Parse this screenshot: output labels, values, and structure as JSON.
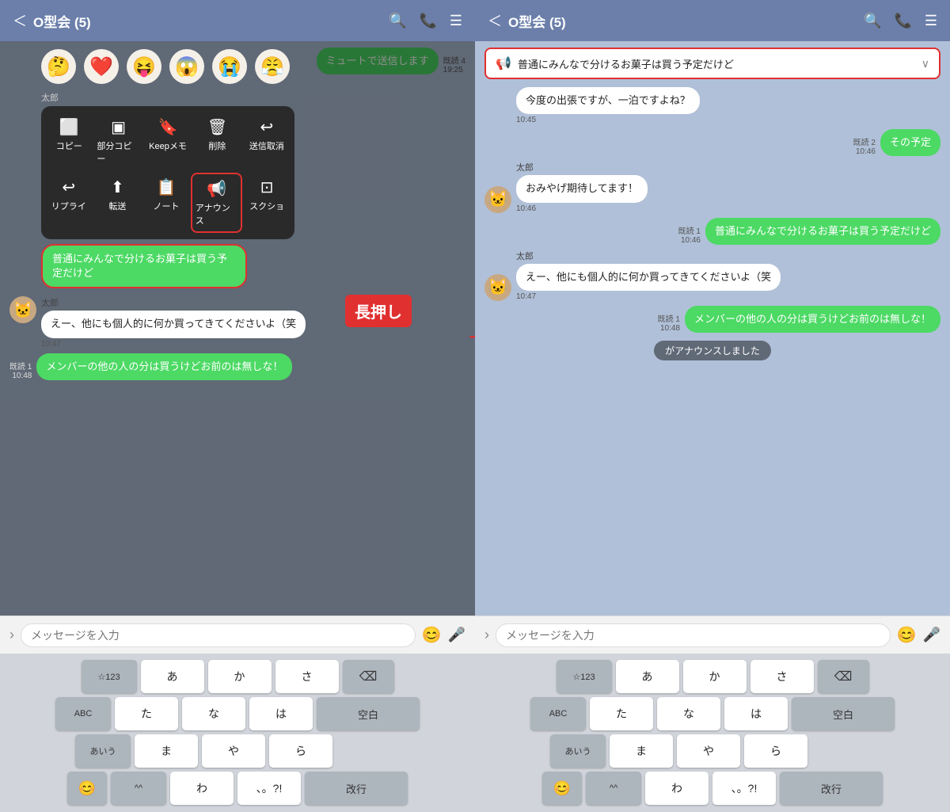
{
  "left_panel": {
    "header": {
      "back": "＜",
      "title": "O型会 (5)",
      "search": "🔍",
      "phone": "📞",
      "menu": "≡"
    },
    "top_message": {
      "read": "既読 4",
      "time": "19:25",
      "text": "ミュートで送信します",
      "align": "right"
    },
    "stickers": [
      "🤔",
      "❤️",
      "😝",
      "😱",
      "😭",
      "😤"
    ],
    "context_menu": {
      "row1": [
        {
          "icon": "⬜",
          "label": "コピー"
        },
        {
          "icon": "▣",
          "label": "部分コピー"
        },
        {
          "icon": "🔖",
          "label": "Keepメモ"
        },
        {
          "icon": "🗑",
          "label": "削除"
        },
        {
          "icon": "↩",
          "label": "送信取消"
        }
      ],
      "row2": [
        {
          "icon": "↩",
          "label": "リプライ"
        },
        {
          "icon": "⬆",
          "label": "転送"
        },
        {
          "icon": "📋",
          "label": "ノート"
        },
        {
          "icon": "📢",
          "label": "アナウンス",
          "highlighted": true
        },
        {
          "icon": "⊡",
          "label": "スクショ"
        }
      ]
    },
    "highlighted_message": {
      "text": "普通にみんなで分けるお菓子は買う予定だけど",
      "align": "right",
      "color": "green",
      "border": true
    },
    "messages": [
      {
        "sender": "太郎",
        "avatar": "🐱",
        "text": "えー、他にも個人的に何か買ってきてくださいよ（笑",
        "time": "10:47",
        "align": "left"
      },
      {
        "text": "メンバーの他の人の分は買うけどお前のは無しな！",
        "read": "既読 1",
        "time": "10:48",
        "align": "right",
        "color": "green"
      }
    ],
    "long_press_label": "長押し",
    "input_placeholder": "メッセージを入力",
    "keyboard": {
      "row1": [
        "☆123",
        "あ",
        "か",
        "さ",
        "⌫"
      ],
      "row2": [
        "ABC",
        "た",
        "な",
        "は",
        "空白"
      ],
      "row3": [
        "あいう",
        "ま",
        "や",
        "ら",
        ""
      ],
      "row4": [
        "😊",
        "^^",
        "わ",
        "、。?!",
        "改行"
      ]
    }
  },
  "right_panel": {
    "header": {
      "back": "＜",
      "title": "O型会 (5)",
      "search": "🔍",
      "phone": "📞",
      "menu": "≡"
    },
    "announcement": {
      "icon": "📢",
      "text": "普通にみんなで分けるお菓子は買う予定だけど",
      "chevron": "∨"
    },
    "messages": [
      {
        "text": "今度の出張ですが、一泊ですよね？",
        "time": "10:45",
        "align": "left",
        "no_avatar": true
      },
      {
        "text": "その予定",
        "read": "既読 2",
        "time": "10:46",
        "align": "right",
        "color": "green"
      },
      {
        "sender": "太郎",
        "avatar": "🐱",
        "text": "おみやげ期待してます！",
        "time": "10:46",
        "align": "left"
      },
      {
        "text": "普通にみんなで分けるお菓子は買う予定だけど",
        "read": "既読 1",
        "time": "10:46",
        "align": "right",
        "color": "green"
      },
      {
        "sender": "太郎",
        "avatar": "🐱",
        "text": "えー、他にも個人的に何か買ってきてくださいよ（笑",
        "time": "10:47",
        "align": "left"
      },
      {
        "text": "メンバーの他の人の分は買うけどお前のは無しな！",
        "read": "既読 1",
        "time": "10:48",
        "align": "right",
        "color": "green"
      }
    ],
    "announce_notification": "がアナウンスしました",
    "input_placeholder": "メッセージを入力",
    "keyboard": {
      "row1": [
        "☆123",
        "あ",
        "か",
        "さ",
        "⌫"
      ],
      "row2": [
        "ABC",
        "た",
        "な",
        "は",
        "空白"
      ],
      "row3": [
        "あいう",
        "ま",
        "や",
        "ら",
        ""
      ],
      "row4": [
        "😊",
        "^^",
        "わ",
        "、。?!",
        "改行"
      ]
    }
  }
}
